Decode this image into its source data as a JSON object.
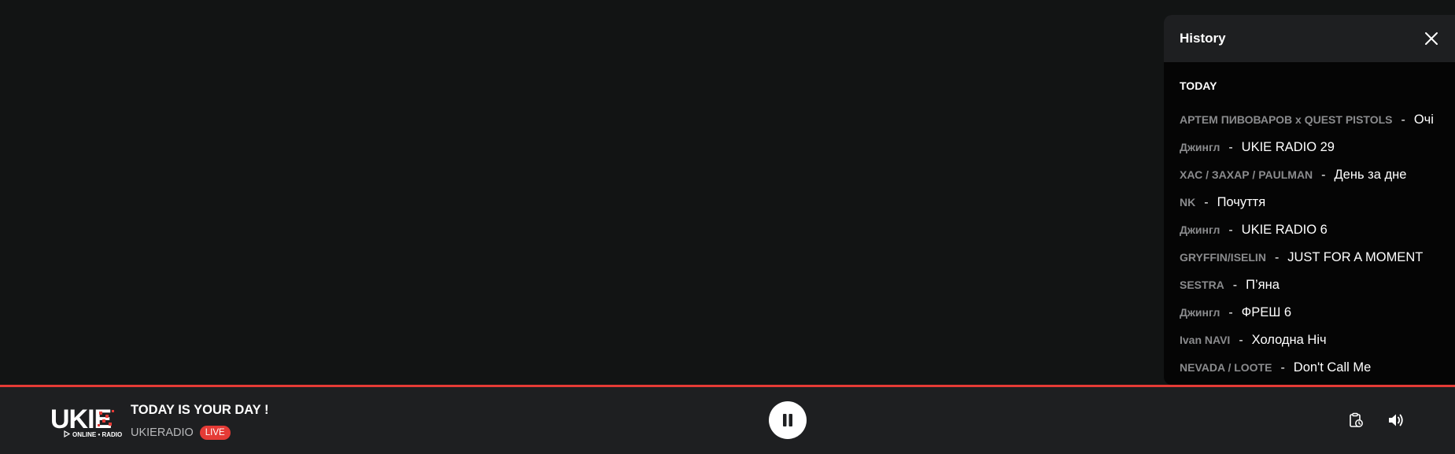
{
  "history": {
    "title": "History",
    "section_label": "TODAY",
    "tracks": [
      {
        "artist": "АРТЕМ ПИВОВАРОВ x QUEST PISTOLS",
        "title": "Очі"
      },
      {
        "artist": "Джингл",
        "title": "UKIE RADIO 29"
      },
      {
        "artist": "ХАС / ЗАХАР / PAULMAN",
        "title": "День за дне"
      },
      {
        "artist": "NK",
        "title": "Почуття"
      },
      {
        "artist": "Джингл",
        "title": "UKIE RADIO 6"
      },
      {
        "artist": "GRYFFIN/ISELIN",
        "title": "JUST FOR A MOMENT"
      },
      {
        "artist": "SESTRA",
        "title": "П’яна"
      },
      {
        "artist": "Джингл",
        "title": "ФРЕШ 6"
      },
      {
        "artist": "Ivan NAVI",
        "title": "Холодна Ніч"
      },
      {
        "artist": "NEVADA / LOOTE",
        "title": "Don't Call Me"
      }
    ],
    "separator": "-",
    "close_icon": "close-icon"
  },
  "player": {
    "logo": {
      "text": "UKIE",
      "subtext": "ONLINE • RADIO"
    },
    "now_playing": "TODAY IS YOUR DAY !",
    "station": "UKIERADIO",
    "live_label": "LIVE",
    "pause_icon": "pause-icon",
    "history_icon": "history-icon",
    "volume_icon": "volume-icon"
  },
  "colors": {
    "background": "#121414",
    "panel": "#050505",
    "bar": "#1e1f21",
    "accent": "#e53b36",
    "muted_text": "#8a8b8d"
  }
}
